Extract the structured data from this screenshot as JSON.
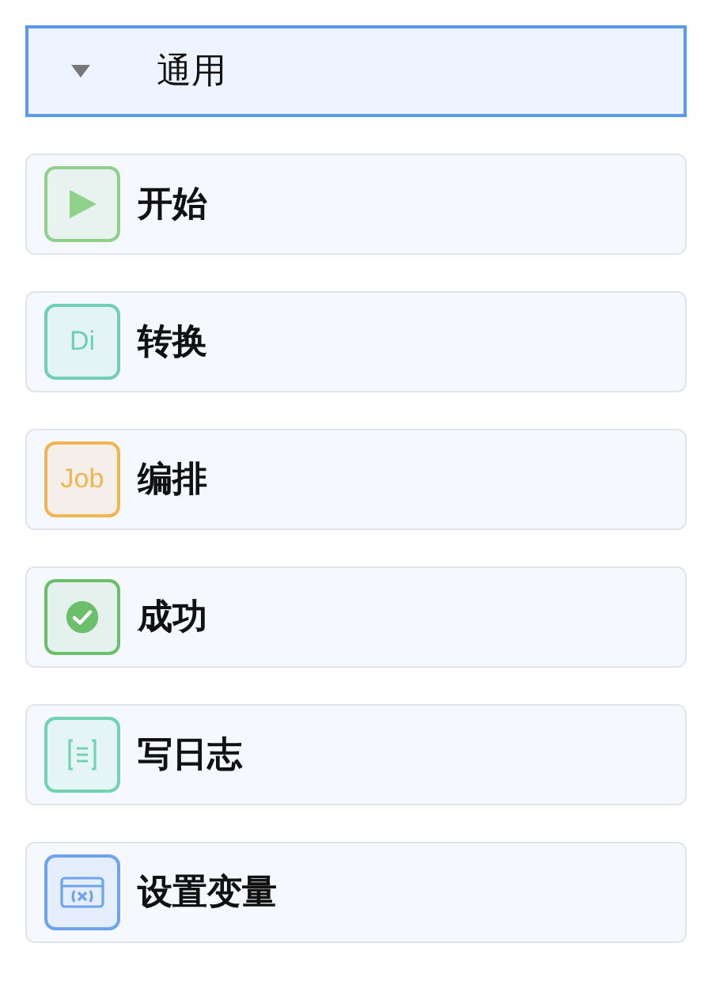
{
  "group": {
    "title": "通用",
    "expanded": true
  },
  "items": [
    {
      "label": "开始",
      "kind": "play",
      "color": "#8fd18a"
    },
    {
      "label": "转换",
      "kind": "text",
      "icon_text": "Di",
      "color": "#6fd0b5"
    },
    {
      "label": "编排",
      "kind": "text",
      "icon_text": "Job",
      "color": "#f0b553"
    },
    {
      "label": "成功",
      "kind": "check",
      "color": "#6cbf6a"
    },
    {
      "label": "写日志",
      "kind": "log",
      "color": "#72d3b3"
    },
    {
      "label": "设置变量",
      "kind": "variable",
      "color": "#6fa3ef"
    }
  ]
}
